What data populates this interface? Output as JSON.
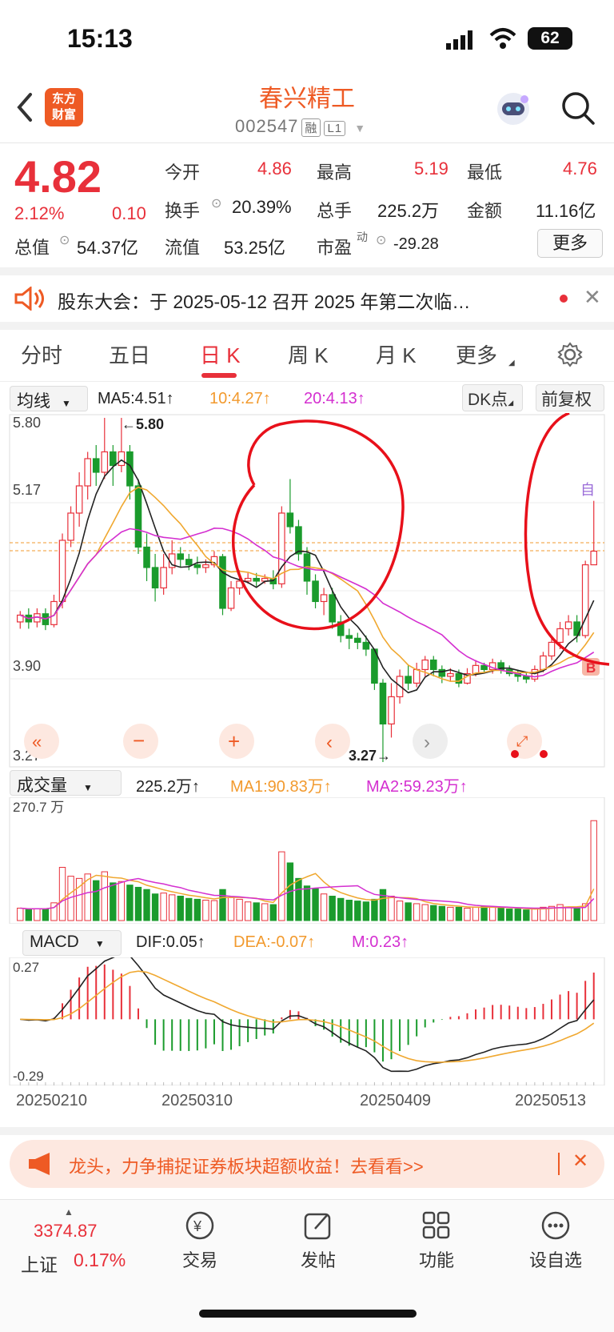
{
  "status": {
    "time": "15:13",
    "battery": "62"
  },
  "header": {
    "logo": [
      "东方",
      "财富"
    ],
    "title": "春兴精工",
    "code": "002547",
    "tags": [
      "融",
      "L1"
    ]
  },
  "quote": {
    "price": "4.82",
    "change_pct": "2.12%",
    "change": "0.10",
    "fields": [
      {
        "label": "今开",
        "value": "4.86"
      },
      {
        "label": "最高",
        "value": "5.19"
      },
      {
        "label": "最低",
        "value": "4.76"
      },
      {
        "label": "换手",
        "value": "20.39%"
      },
      {
        "label": "总手",
        "value": "225.2万"
      },
      {
        "label": "金额",
        "value": "11.16亿"
      },
      {
        "label": "总值",
        "value": "54.37亿"
      },
      {
        "label": "流值",
        "value": "53.25亿"
      },
      {
        "label": "市盈",
        "sup": "动",
        "value": "-29.28"
      }
    ],
    "more_button": "更多"
  },
  "notice": {
    "text": "股东大会：于 2025-05-12 召开 2025 年第二次临…"
  },
  "tabs": [
    "分时",
    "五日",
    "日 K",
    "周 K",
    "月 K",
    "更多"
  ],
  "active_tab": 2,
  "kline": {
    "indicator": "均线",
    "ma5": "MA5:4.51↑",
    "ma10": "10:4.27↑",
    "ma20": "20:4.13↑",
    "dk_button": "DK点",
    "adjust_button": "前复权",
    "y_labels": [
      "5.80",
      "5.17",
      "3.90",
      "3.27"
    ],
    "high_marker": "←5.80",
    "low_marker": "3.27→",
    "self_marker": "自",
    "buy_marker": "B",
    "colors": {
      "up": "#e8303a",
      "down": "#1a9b2c",
      "ma5": "#222222",
      "ma10": "#f0a830",
      "ma20": "#d42fd0"
    }
  },
  "volume": {
    "indicator": "成交量",
    "value": "225.2万↑",
    "ma1": "MA1:90.83万↑",
    "ma2": "MA2:59.23万↑",
    "y_label": "270.7 万"
  },
  "macd": {
    "indicator": "MACD",
    "dif": "DIF:0.05↑",
    "dea": "DEA:-0.07↑",
    "m": "M:0.23↑",
    "y_labels": [
      "0.27",
      "-0.29"
    ]
  },
  "dates": [
    "20250210",
    "20250310",
    "20250409",
    "20250513"
  ],
  "banner": {
    "text": "龙头，力争捕捉证券板块超额收益！去看看>>"
  },
  "bottom_nav": {
    "index_value": "3374.87",
    "index_name": "上证",
    "index_change": "0.17%",
    "items": [
      "交易",
      "发帖",
      "功能",
      "设自选"
    ]
  },
  "chart_data": {
    "type": "candlestick",
    "ylim": [
      3.27,
      5.8
    ],
    "candles": [
      [
        4.3,
        4.35,
        4.25,
        4.38
      ],
      [
        4.35,
        4.3,
        4.25,
        4.4
      ],
      [
        4.3,
        4.36,
        4.26,
        4.4
      ],
      [
        4.36,
        4.28,
        4.24,
        4.4
      ],
      [
        4.28,
        4.45,
        4.26,
        4.5
      ],
      [
        4.45,
        4.9,
        4.4,
        4.95
      ],
      [
        4.9,
        5.1,
        4.85,
        5.15
      ],
      [
        5.1,
        5.3,
        5.0,
        5.4
      ],
      [
        5.3,
        5.5,
        5.2,
        5.55
      ],
      [
        5.5,
        5.4,
        5.3,
        5.6
      ],
      [
        5.4,
        5.55,
        5.35,
        5.8
      ],
      [
        5.55,
        5.45,
        5.3,
        5.6
      ],
      [
        5.45,
        5.55,
        5.4,
        5.8
      ],
      [
        5.55,
        5.3,
        5.2,
        5.6
      ],
      [
        5.3,
        4.85,
        4.8,
        5.35
      ],
      [
        4.85,
        4.7,
        4.6,
        4.95
      ],
      [
        4.7,
        4.55,
        4.45,
        4.8
      ],
      [
        4.55,
        4.7,
        4.5,
        4.8
      ],
      [
        4.7,
        4.8,
        4.65,
        4.9
      ],
      [
        4.8,
        4.76,
        4.7,
        4.85
      ],
      [
        4.76,
        4.72,
        4.68,
        4.8
      ],
      [
        4.72,
        4.7,
        4.65,
        4.78
      ],
      [
        4.7,
        4.72,
        4.66,
        4.76
      ],
      [
        4.72,
        4.78,
        4.7,
        4.82
      ],
      [
        4.78,
        4.4,
        4.35,
        4.8
      ],
      [
        4.4,
        4.55,
        4.38,
        4.6
      ],
      [
        4.55,
        4.6,
        4.5,
        4.68
      ],
      [
        4.6,
        4.62,
        4.58,
        4.66
      ],
      [
        4.62,
        4.6,
        4.56,
        4.66
      ],
      [
        4.6,
        4.62,
        4.58,
        4.65
      ],
      [
        4.62,
        4.58,
        4.54,
        4.68
      ],
      [
        4.58,
        5.1,
        4.55,
        5.15
      ],
      [
        5.1,
        5.0,
        4.95,
        5.35
      ],
      [
        5.0,
        4.8,
        4.75,
        5.05
      ],
      [
        4.8,
        4.6,
        4.5,
        4.85
      ],
      [
        4.6,
        4.45,
        4.4,
        4.65
      ],
      [
        4.45,
        4.5,
        4.35,
        4.55
      ],
      [
        4.5,
        4.3,
        4.25,
        4.55
      ],
      [
        4.3,
        4.2,
        4.15,
        4.35
      ],
      [
        4.2,
        4.18,
        4.1,
        4.25
      ],
      [
        4.18,
        4.15,
        4.1,
        4.22
      ],
      [
        4.15,
        4.1,
        4.05,
        4.2
      ],
      [
        4.1,
        3.85,
        3.8,
        4.1
      ],
      [
        3.85,
        3.55,
        3.27,
        3.88
      ],
      [
        3.55,
        3.75,
        3.45,
        3.85
      ],
      [
        3.75,
        3.9,
        3.7,
        3.95
      ],
      [
        3.9,
        3.85,
        3.8,
        3.98
      ],
      [
        3.85,
        3.95,
        3.82,
        4.0
      ],
      [
        3.95,
        4.02,
        3.9,
        4.05
      ],
      [
        4.02,
        3.95,
        3.9,
        4.05
      ],
      [
        3.95,
        3.9,
        3.85,
        3.98
      ],
      [
        3.9,
        3.92,
        3.86,
        3.96
      ],
      [
        3.92,
        3.85,
        3.82,
        3.95
      ],
      [
        3.85,
        3.92,
        3.84,
        3.96
      ],
      [
        3.92,
        3.98,
        3.9,
        4.02
      ],
      [
        3.98,
        3.95,
        3.92,
        4.0
      ],
      [
        3.95,
        4.0,
        3.92,
        4.03
      ],
      [
        4.0,
        3.95,
        3.92,
        4.02
      ],
      [
        3.95,
        3.92,
        3.9,
        3.98
      ],
      [
        3.92,
        3.9,
        3.86,
        3.95
      ],
      [
        3.9,
        3.88,
        3.85,
        3.93
      ],
      [
        3.88,
        3.95,
        3.86,
        3.98
      ],
      [
        3.95,
        4.05,
        3.93,
        4.08
      ],
      [
        4.05,
        4.15,
        4.02,
        4.2
      ],
      [
        4.15,
        4.25,
        4.1,
        4.3
      ],
      [
        4.25,
        4.3,
        4.2,
        4.35
      ],
      [
        4.3,
        4.2,
        4.15,
        4.35
      ],
      [
        4.2,
        4.72,
        4.18,
        4.75
      ],
      [
        4.72,
        4.82,
        4.76,
        5.19
      ]
    ],
    "volume": [
      28,
      25,
      27,
      26,
      40,
      120,
      100,
      95,
      105,
      90,
      110,
      85,
      88,
      80,
      75,
      70,
      60,
      62,
      58,
      55,
      50,
      48,
      46,
      45,
      70,
      52,
      48,
      42,
      40,
      38,
      36,
      155,
      130,
      95,
      78,
      72,
      60,
      55,
      50,
      46,
      44,
      42,
      48,
      70,
      55,
      44,
      40,
      38,
      36,
      34,
      32,
      30,
      30,
      28,
      30,
      32,
      30,
      28,
      26,
      26,
      24,
      26,
      30,
      32,
      36,
      30,
      28,
      38,
      225.2
    ],
    "volume_max": 270.7,
    "macd_ylim": [
      -0.29,
      0.27
    ]
  }
}
